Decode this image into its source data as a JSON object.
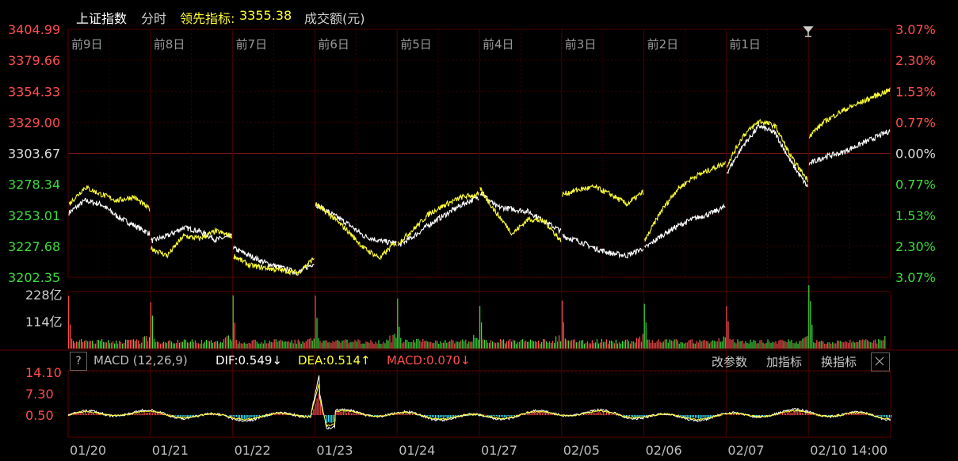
{
  "header": {
    "index_name": "上证指数",
    "period": "分时",
    "lead_label": "领先指标:",
    "lead_value": "3355.38",
    "volume_label": "成交额(元)"
  },
  "price_axis": {
    "left": [
      "3404.99",
      "3379.66",
      "3354.33",
      "3329.00",
      "3303.67",
      "3278.34",
      "3253.01",
      "3227.68",
      "3202.35"
    ],
    "right": [
      "3.07%",
      "2.30%",
      "1.53%",
      "0.77%",
      "0.00%",
      "0.77%",
      "1.53%",
      "2.30%",
      "3.07%"
    ]
  },
  "day_labels": [
    "前9日",
    "前8日",
    "前7日",
    "前6日",
    "前5日",
    "前4日",
    "前3日",
    "前2日",
    "前1日"
  ],
  "volume_axis": [
    "228亿",
    "114亿"
  ],
  "macd": {
    "help": "?",
    "title": "MACD (12,26,9)",
    "dif": "DIF:0.549↓",
    "dea": "DEA:0.514↑",
    "macd": "MACD:0.070↓",
    "axis": [
      "14.10",
      "7.30",
      "0.50"
    ],
    "buttons": {
      "params": "改参数",
      "add": "加指标",
      "switch": "换指标"
    }
  },
  "date_labels": [
    "01/20",
    "01/21",
    "01/22",
    "01/23",
    "01/24",
    "01/27",
    "02/05",
    "02/06",
    "02/07",
    "02/10"
  ],
  "time_label": "14:00",
  "colors": {
    "up": "#ff4d4d",
    "down": "#3ddc3d",
    "price_line": "#ffffff",
    "lead_line": "#ffff33",
    "macd_pos": "#ff4d4d",
    "macd_neg": "#33e6ff",
    "grid": "#3a0000",
    "header_yellow": "#ffff33"
  },
  "chart_data": {
    "type": "line",
    "title": "上证指数",
    "ylim": [
      3202.35,
      3404.99
    ],
    "prev_close": 3303.67,
    "day_count": 10,
    "series": [
      {
        "name": "上证指数",
        "daily_points": [
          [
            3255,
            3265,
            3262,
            3252,
            3245,
            3238
          ],
          [
            3232,
            3236,
            3243,
            3240,
            3233,
            3236
          ],
          [
            3226,
            3220,
            3214,
            3210,
            3206,
            3214
          ],
          [
            3262,
            3254,
            3246,
            3236,
            3232,
            3230
          ],
          [
            3228,
            3236,
            3246,
            3254,
            3262,
            3268
          ],
          [
            3272,
            3260,
            3258,
            3256,
            3248,
            3240
          ],
          [
            3236,
            3232,
            3226,
            3222,
            3220,
            3226
          ],
          [
            3226,
            3236,
            3244,
            3250,
            3254,
            3260
          ],
          [
            3288,
            3310,
            3326,
            3320,
            3296,
            3276
          ],
          [
            3295,
            3301,
            3304,
            3310,
            3316,
            3322
          ]
        ]
      },
      {
        "name": "领先指标",
        "daily_points": [
          [
            3262,
            3276,
            3270,
            3265,
            3268,
            3258
          ],
          [
            3226,
            3220,
            3236,
            3234,
            3240,
            3236
          ],
          [
            3220,
            3212,
            3210,
            3208,
            3206,
            3218
          ],
          [
            3262,
            3252,
            3240,
            3226,
            3218,
            3232
          ],
          [
            3230,
            3242,
            3255,
            3262,
            3268,
            3270
          ],
          [
            3274,
            3255,
            3238,
            3250,
            3248,
            3232
          ],
          [
            3270,
            3274,
            3276,
            3270,
            3262,
            3272
          ],
          [
            3232,
            3256,
            3274,
            3284,
            3290,
            3296
          ],
          [
            3294,
            3318,
            3330,
            3326,
            3300,
            3282
          ],
          [
            3318,
            3330,
            3338,
            3344,
            3350,
            3355.38
          ]
        ]
      }
    ]
  }
}
